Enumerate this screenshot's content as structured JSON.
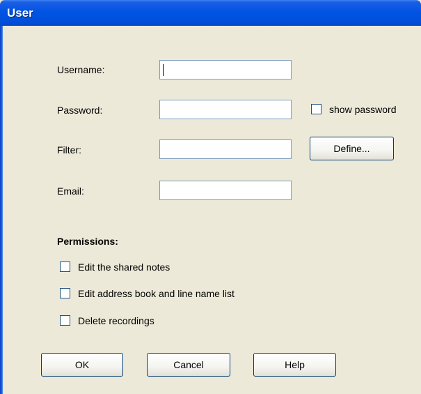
{
  "window": {
    "title": "User"
  },
  "form": {
    "username_label": "Username:",
    "username_value": "",
    "password_label": "Password:",
    "password_value": "",
    "show_password_label": "show password",
    "show_password_checked": false,
    "filter_label": "Filter:",
    "filter_value": "",
    "define_button": "Define...",
    "email_label": "Email:",
    "email_value": ""
  },
  "permissions": {
    "heading": "Permissions:",
    "items": [
      {
        "label": "Edit the shared notes",
        "checked": false
      },
      {
        "label": "Edit address book and line name list",
        "checked": false
      },
      {
        "label": "Delete recordings",
        "checked": false
      }
    ]
  },
  "buttons": {
    "ok": "OK",
    "cancel": "Cancel",
    "help": "Help"
  },
  "colors": {
    "titlebar": "#0054e3",
    "dialog_bg": "#ece9d8",
    "button_border": "#003c74",
    "textbox_border": "#7f9db9"
  }
}
